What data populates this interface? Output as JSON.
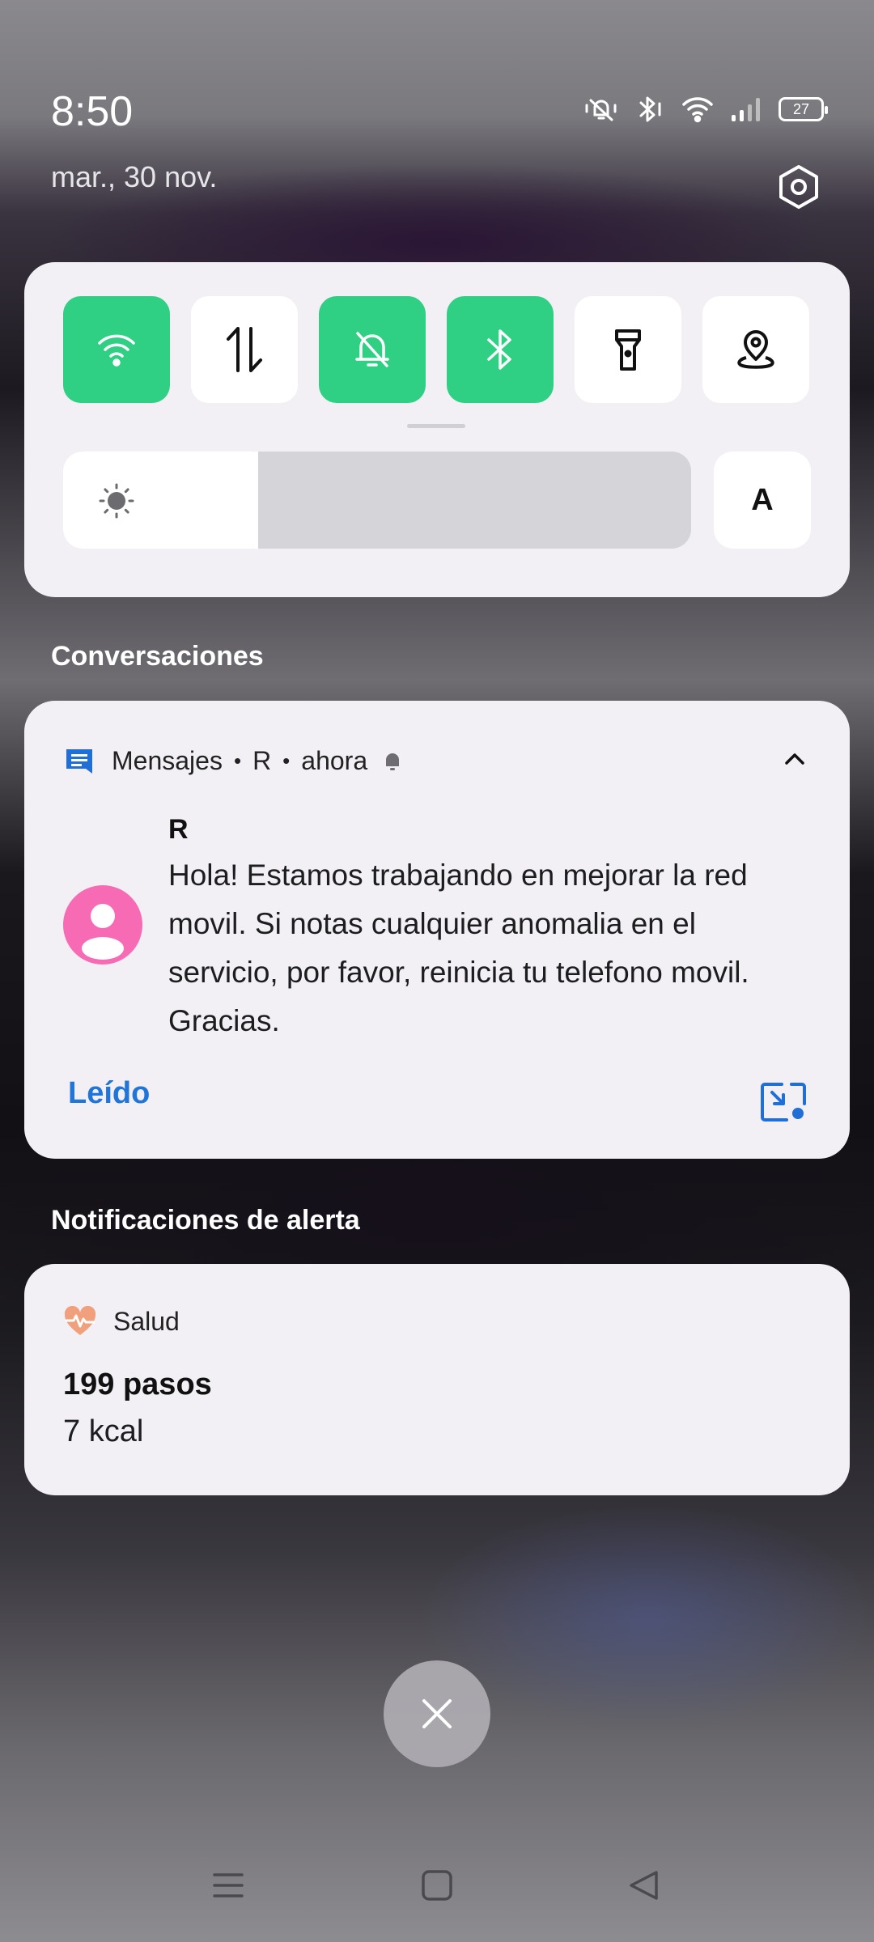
{
  "status_bar": {
    "time": "8:50",
    "date": "mar., 30 nov.",
    "battery": "27",
    "icons": [
      "mute-icon",
      "bluetooth-icon",
      "wifi-icon",
      "signal-icon",
      "battery-icon"
    ]
  },
  "quick_settings": {
    "tiles": [
      {
        "name": "wifi",
        "active": true
      },
      {
        "name": "mobile-data",
        "active": false
      },
      {
        "name": "silent-mode",
        "active": true
      },
      {
        "name": "bluetooth",
        "active": true
      },
      {
        "name": "flashlight",
        "active": false
      },
      {
        "name": "location",
        "active": false
      }
    ],
    "brightness_level": 0.31,
    "auto_label": "A",
    "accent_color": "#2fcf84"
  },
  "sections": {
    "conversations": "Conversaciones",
    "alerts": "Notificaciones de alerta"
  },
  "message_notification": {
    "app": "Mensajes",
    "sender_short": "R",
    "time": "ahora",
    "sender": "R",
    "body": "Hola! Estamos trabajando en mejorar la red movil. Si notas cualquier anomalia en el servicio, por favor, reinicia tu telefono movil. Gracias.",
    "action_read": "Leído",
    "avatar_color": "#f76ab4"
  },
  "health_notification": {
    "app": "Salud",
    "steps": "199 pasos",
    "kcal": "7 kcal"
  }
}
